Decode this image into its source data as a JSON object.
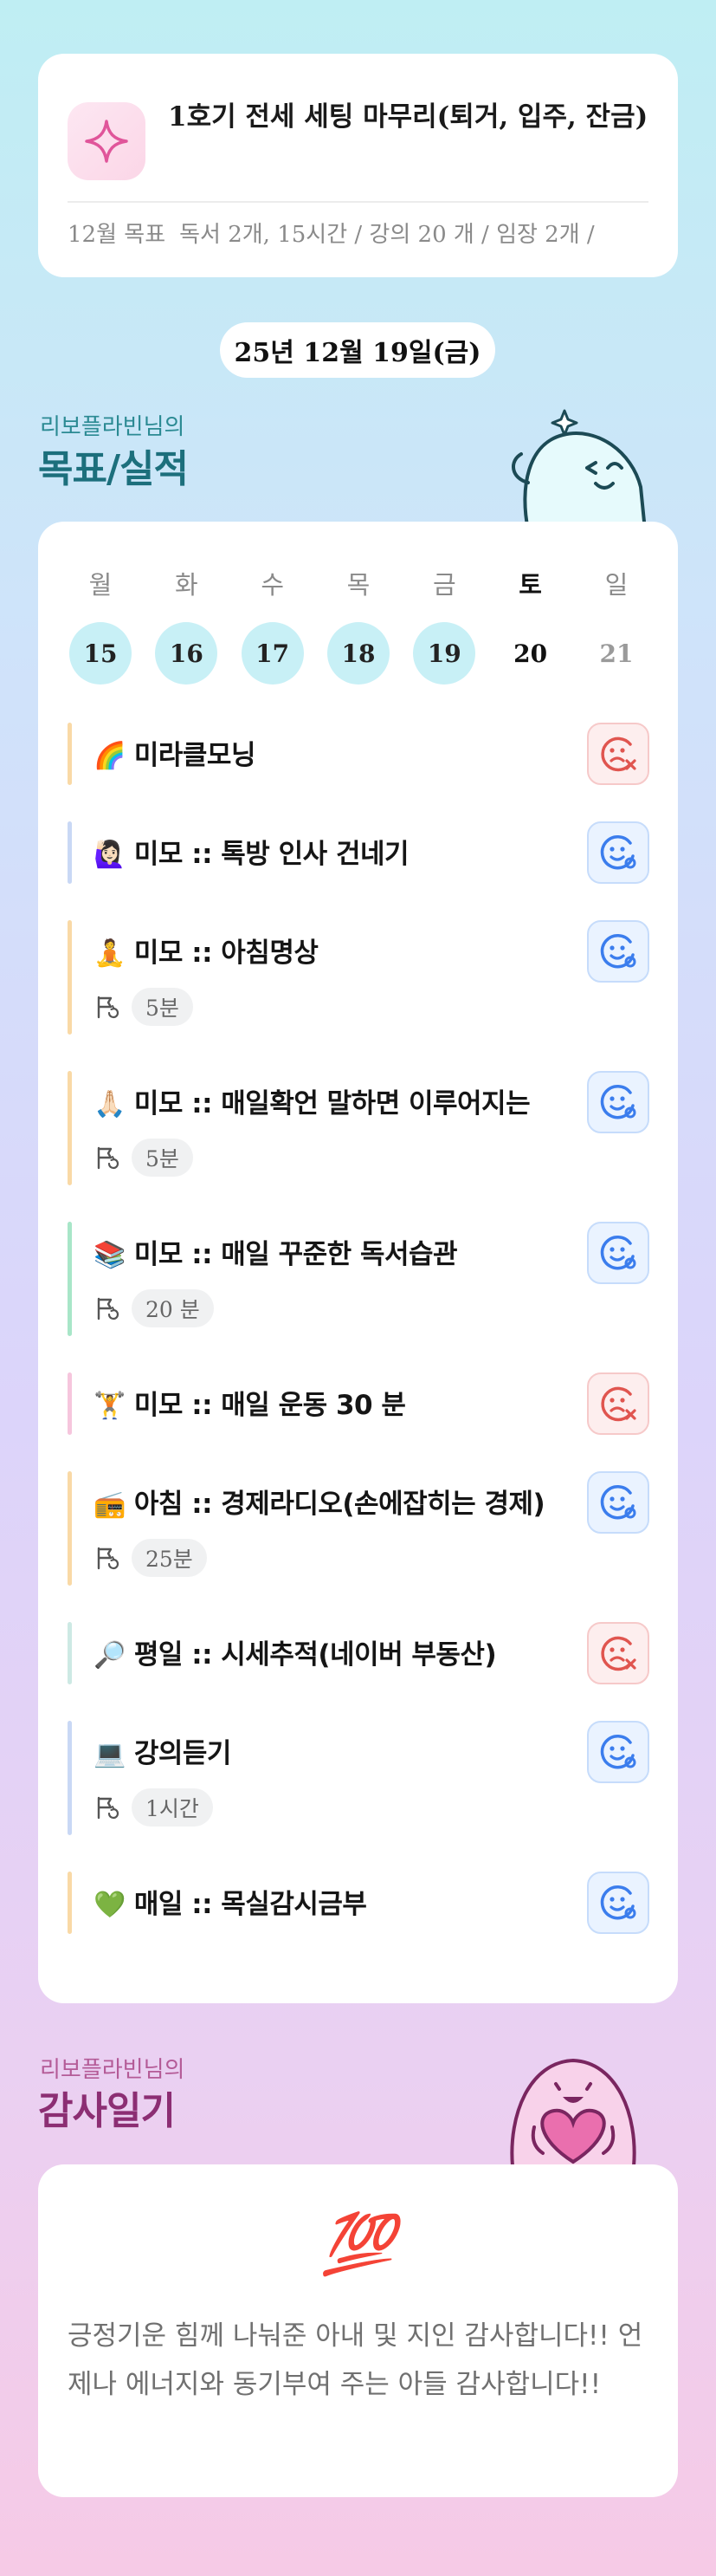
{
  "goal": {
    "icon": "sparkle-icon",
    "title": "1호기 전세 세팅 마무리(퇴거, 입주, 잔금)",
    "meta_label": "12월 목표",
    "meta_text": "독서 2개, 15시간 / 강의 20 개 / 임장 2개 /"
  },
  "date": "25년 12월 19일(금)",
  "goals_section": {
    "subtitle": "리보플라빈님의",
    "title": "목표/실적"
  },
  "week": {
    "weekdays": [
      "월",
      "화",
      "수",
      "목",
      "금",
      "토",
      "일"
    ],
    "days": [
      "15",
      "16",
      "17",
      "18",
      "19",
      "20",
      "21"
    ],
    "done_days": [
      true,
      true,
      true,
      true,
      true,
      false,
      false
    ],
    "today_index": 5
  },
  "habits": [
    {
      "emoji": "🌈",
      "name": "미라클모닝",
      "duration": "",
      "status": "bad",
      "color": "#f9d9a6"
    },
    {
      "emoji": "🙋🏻‍♀️",
      "name": "미모 :: 톡방 인사 건네기",
      "duration": "",
      "status": "good",
      "color": "#c9d8f5"
    },
    {
      "emoji": "🧘",
      "name": "미모 :: 아침명상",
      "duration": "5분",
      "status": "good",
      "color": "#f9d9a6"
    },
    {
      "emoji": "🙏🏻",
      "name": "미모 :: 매일확언 말하면 이루어지는",
      "duration": "5분",
      "status": "good",
      "color": "#f9d9a6"
    },
    {
      "emoji": "📚",
      "name": "미모 :: 매일 꾸준한 독서습관",
      "duration": "20 분",
      "status": "good",
      "color": "#a8e6c8"
    },
    {
      "emoji": "🏋️",
      "name": "미모 :: 매일 운동 30 분",
      "duration": "",
      "status": "bad",
      "color": "#f6c6dd"
    },
    {
      "emoji": "📻",
      "name": "아침 :: 경제라디오(손에잡히는 경제)",
      "duration": "25분",
      "status": "good",
      "color": "#f9d9a6"
    },
    {
      "emoji": "🔎",
      "name": "평일 :: 시세추적(네이버 부동산)",
      "duration": "",
      "status": "bad",
      "color": "#cde9e4"
    },
    {
      "emoji": "💻",
      "name": "강의듣기",
      "duration": "1시간",
      "status": "good",
      "color": "#c9d8f5"
    },
    {
      "emoji": "💚",
      "name": "매일 :: 목실감시금부",
      "duration": "",
      "status": "good",
      "color": "#f9d9a6"
    }
  ],
  "gratitude_section": {
    "subtitle": "리보플라빈님의",
    "title": "감사일기"
  },
  "gratitude": {
    "emoji": "💯",
    "text": "긍정기운 힘께 나눠준 아내 및 지인 감사합니다!! 언제나 에너지와 동기부여 주는 아들 감사합니다!!"
  },
  "colors": {
    "good_icon": "#3b7ded",
    "bad_icon": "#e0554f",
    "goals_title": "#1c6f7c",
    "gratitude_title": "#8c2e73"
  }
}
